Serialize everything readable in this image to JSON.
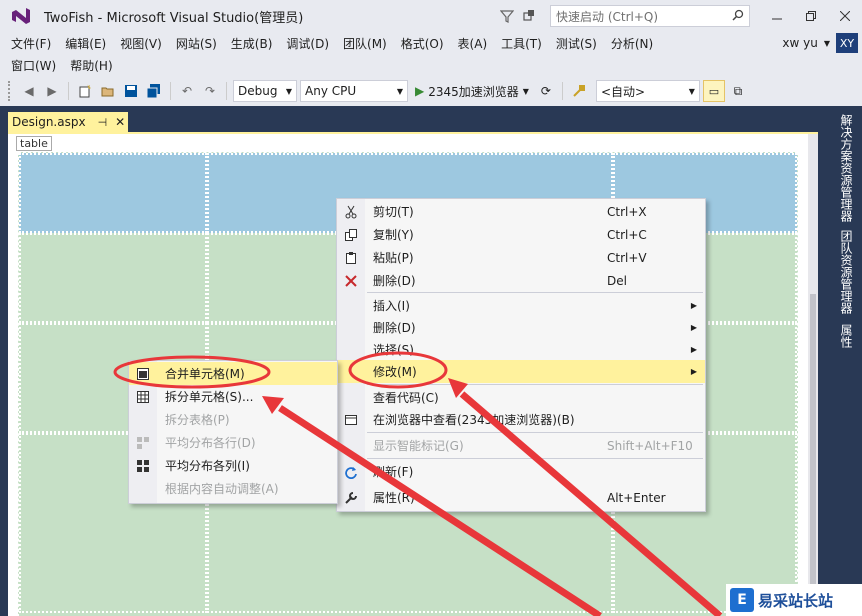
{
  "window": {
    "title": "TwoFish - Microsoft Visual Studio(管理员)",
    "quick_launch_placeholder": "快速启动 (Ctrl+Q)"
  },
  "menu": {
    "row1": [
      "文件(F)",
      "编辑(E)",
      "视图(V)",
      "网站(S)",
      "生成(B)",
      "调试(D)",
      "团队(M)",
      "格式(O)",
      "表(A)",
      "工具(T)",
      "测试(S)",
      "分析(N)"
    ],
    "row2": [
      "窗口(W)",
      "帮助(H)"
    ],
    "user_name": "xw yu",
    "avatar_initials": "XY"
  },
  "toolbar": {
    "config": "Debug",
    "platform": "Any CPU",
    "run_label": "2345加速浏览器",
    "target": "<自动>"
  },
  "document": {
    "tab_label": "Design.aspx",
    "breadcrumb": "table"
  },
  "side_panel": {
    "labels": [
      "解决方案资源管理器",
      "团队资源管理器",
      "属性"
    ]
  },
  "context_menu": {
    "items": [
      {
        "icon": "scissors-icon",
        "label": "剪切(T)",
        "shortcut": "Ctrl+X",
        "disabled": false
      },
      {
        "icon": "copy-icon",
        "label": "复制(Y)",
        "shortcut": "Ctrl+C",
        "disabled": false
      },
      {
        "icon": "paste-icon",
        "label": "粘贴(P)",
        "shortcut": "Ctrl+V",
        "disabled": false
      },
      {
        "icon": "delete-x-icon",
        "label": "删除(D)",
        "shortcut": "Del",
        "disabled": false
      },
      {
        "icon": "",
        "label": "插入(I)",
        "shortcut": "",
        "submenu": true,
        "disabled": false
      },
      {
        "icon": "",
        "label": "删除(D)",
        "shortcut": "",
        "submenu": true,
        "disabled": false
      },
      {
        "icon": "",
        "label": "选择(S)",
        "shortcut": "",
        "submenu": true,
        "disabled": false
      },
      {
        "icon": "",
        "label": "修改(M)",
        "shortcut": "",
        "submenu": true,
        "highlighted": true,
        "disabled": false
      },
      {
        "icon": "",
        "label": "查看代码(C)",
        "shortcut": "",
        "disabled": false
      },
      {
        "icon": "browser-icon",
        "label": "在浏览器中查看(2345加速浏览器)(B)",
        "shortcut": "",
        "disabled": false
      },
      {
        "icon": "",
        "label": "显示智能标记(G)",
        "shortcut": "Shift+Alt+F10",
        "disabled": true
      },
      {
        "icon": "refresh-icon",
        "label": "刷新(F)",
        "shortcut": "",
        "disabled": false
      },
      {
        "icon": "wrench-icon",
        "label": "属性(R)",
        "shortcut": "Alt+Enter",
        "disabled": false
      }
    ]
  },
  "sub_menu": {
    "items": [
      {
        "icon": "merge-cells-icon",
        "label": "合并单元格(M)",
        "highlighted": true,
        "disabled": false
      },
      {
        "icon": "split-cells-icon",
        "label": "拆分单元格(S)...",
        "disabled": false
      },
      {
        "icon": "",
        "label": "拆分表格(P)",
        "disabled": true
      },
      {
        "icon": "distribute-rows-icon",
        "label": "平均分布各行(D)",
        "disabled": true
      },
      {
        "icon": "distribute-cols-icon",
        "label": "平均分布各列(I)",
        "disabled": false
      },
      {
        "icon": "",
        "label": "根据内容自动调整(A)",
        "disabled": true
      }
    ]
  },
  "watermark": {
    "text": "易采站长站",
    "logo_letter": "E"
  },
  "colors": {
    "highlight": "#fff29d",
    "annotation_red": "#e8373a",
    "table_green": "#c6e0c6",
    "table_selected": "#9dc8e0",
    "chrome": "#e8eaf0",
    "frame": "#293955"
  }
}
